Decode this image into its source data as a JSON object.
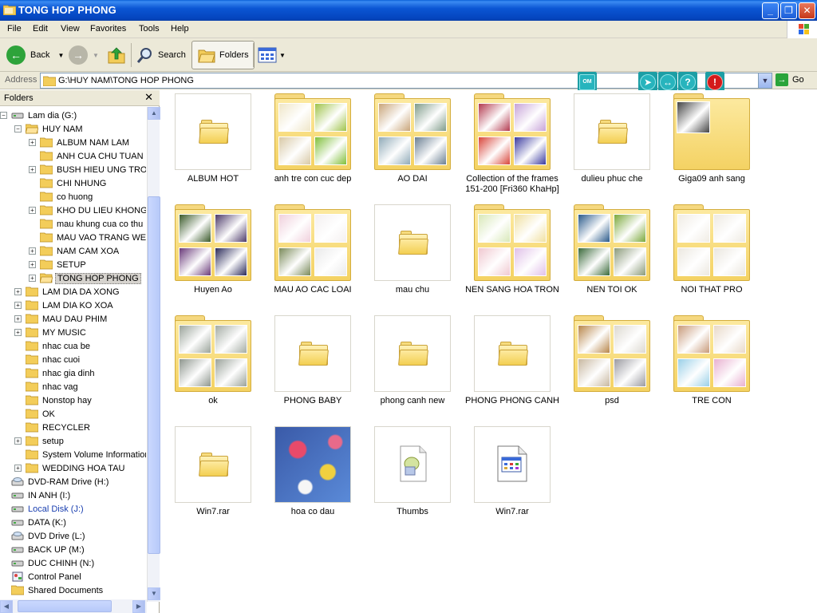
{
  "window": {
    "title": "TONG HOP PHONG",
    "minimize": "_",
    "maximize": "❐",
    "close": "✕"
  },
  "menu": [
    "File",
    "Edit",
    "View",
    "Favorites",
    "Tools",
    "Help"
  ],
  "toolbar": {
    "back_label": "Back",
    "search_label": "Search",
    "folders_label": "Folders"
  },
  "address": {
    "label": "Address",
    "value": "G:\\HUY NAM\\TONG HOP PHONG",
    "go_label": "Go"
  },
  "folders_pane": {
    "title": "Folders",
    "close": "✕",
    "tree": [
      {
        "label": "Lam dia (G:)",
        "level": 0,
        "expander": "-",
        "icon": "drive-icon"
      },
      {
        "label": "HUY NAM",
        "level": 1,
        "expander": "-",
        "icon": "folder-open-icon"
      },
      {
        "label": "ALBUM NAM LAM",
        "level": 2,
        "expander": "+",
        "icon": "folder-icon"
      },
      {
        "label": "ANH CUA CHU TUAN",
        "level": 2,
        "expander": "",
        "icon": "folder-icon"
      },
      {
        "label": "BUSH HIEU UNG TRONG",
        "level": 2,
        "expander": "+",
        "icon": "folder-icon"
      },
      {
        "label": "CHI NHUNG",
        "level": 2,
        "expander": "",
        "icon": "folder-icon"
      },
      {
        "label": "co huong",
        "level": 2,
        "expander": "",
        "icon": "folder-icon"
      },
      {
        "label": "KHO DU LIEU KHONG XO",
        "level": 2,
        "expander": "+",
        "icon": "folder-icon"
      },
      {
        "label": "mau khung cua co thu",
        "level": 2,
        "expander": "",
        "icon": "folder-icon"
      },
      {
        "label": "MAU VAO TRANG WEB",
        "level": 2,
        "expander": "",
        "icon": "folder-icon"
      },
      {
        "label": "NAM CAM XOA",
        "level": 2,
        "expander": "+",
        "icon": "folder-icon"
      },
      {
        "label": "SETUP",
        "level": 2,
        "expander": "+",
        "icon": "folder-icon"
      },
      {
        "label": "TONG HOP PHONG",
        "level": 2,
        "expander": "+",
        "icon": "folder-open-icon",
        "selected": true
      },
      {
        "label": "LAM DIA DA XONG",
        "level": 1,
        "expander": "+",
        "icon": "folder-icon"
      },
      {
        "label": "LAM DIA KO XOA",
        "level": 1,
        "expander": "+",
        "icon": "folder-icon"
      },
      {
        "label": "MAU DAU PHIM",
        "level": 1,
        "expander": "+",
        "icon": "folder-icon"
      },
      {
        "label": "MY MUSIC",
        "level": 1,
        "expander": "+",
        "icon": "folder-icon"
      },
      {
        "label": "nhac cua be",
        "level": 1,
        "expander": "",
        "icon": "folder-icon"
      },
      {
        "label": "nhac cuoi",
        "level": 1,
        "expander": "",
        "icon": "folder-icon"
      },
      {
        "label": "nhac gia dinh",
        "level": 1,
        "expander": "",
        "icon": "folder-icon"
      },
      {
        "label": "nhac vag",
        "level": 1,
        "expander": "",
        "icon": "folder-icon"
      },
      {
        "label": "Nonstop hay",
        "level": 1,
        "expander": "",
        "icon": "folder-icon"
      },
      {
        "label": "OK",
        "level": 1,
        "expander": "",
        "icon": "folder-icon"
      },
      {
        "label": "RECYCLER",
        "level": 1,
        "expander": "",
        "icon": "folder-icon"
      },
      {
        "label": "setup",
        "level": 1,
        "expander": "+",
        "icon": "folder-icon"
      },
      {
        "label": "System Volume Information",
        "level": 1,
        "expander": "",
        "icon": "folder-icon"
      },
      {
        "label": "WEDDING HOA TAU",
        "level": 1,
        "expander": "+",
        "icon": "folder-icon"
      },
      {
        "label": "DVD-RAM Drive (H:)",
        "level": 0,
        "expander": "",
        "icon": "dvd-drive-icon"
      },
      {
        "label": "IN ANH (I:)",
        "level": 0,
        "expander": "",
        "icon": "drive-icon"
      },
      {
        "label": "Local Disk (J:)",
        "level": 0,
        "expander": "",
        "icon": "drive-icon",
        "blue": true
      },
      {
        "label": "DATA (K:)",
        "level": 0,
        "expander": "",
        "icon": "drive-icon"
      },
      {
        "label": "DVD Drive (L:)",
        "level": 0,
        "expander": "",
        "icon": "dvd-drive-icon"
      },
      {
        "label": "BACK UP (M:)",
        "level": 0,
        "expander": "",
        "icon": "drive-icon"
      },
      {
        "label": "DUC CHINH (N:)",
        "level": 0,
        "expander": "",
        "icon": "drive-icon"
      },
      {
        "label": "Control Panel",
        "level": 0,
        "expander": "",
        "icon": "control-panel-icon"
      },
      {
        "label": "Shared Documents",
        "level": 0,
        "expander": "",
        "icon": "folder-icon"
      }
    ]
  },
  "items": [
    {
      "label": "ALBUM HOT",
      "kind": "empty-folder"
    },
    {
      "label": "anh tre con cuc dep",
      "kind": "photo-folder",
      "palette": [
        "#efe6c8",
        "#9fc34a",
        "#d8c9a6",
        "#7fbf3a"
      ]
    },
    {
      "label": "AO DAI",
      "kind": "photo-folder",
      "palette": [
        "#c9a57a",
        "#7f9b8a",
        "#8faab8",
        "#6b7f92"
      ]
    },
    {
      "label": "Collection of the frames 151-200 [Fri360 KhaHp]",
      "kind": "photo-folder",
      "palette": [
        "#b33a4f",
        "#c7a3d8",
        "#d8453a",
        "#3a3a9f"
      ]
    },
    {
      "label": "dulieu phuc che",
      "kind": "empty-folder"
    },
    {
      "label": "Giga09 anh sang",
      "kind": "single-photo-folder",
      "palette": [
        "#444444"
      ]
    },
    {
      "label": "Huyen Ao",
      "kind": "photo-folder",
      "palette": [
        "#3a5a2a",
        "#4c3a6a",
        "#6a3a7a",
        "#2a2a5a"
      ]
    },
    {
      "label": "MAU AO CAC LOAI",
      "kind": "photo-folder",
      "palette": [
        "#f0d0dc",
        "#f4f0f0",
        "#7a8a5a",
        "#eaeaea"
      ]
    },
    {
      "label": "mau chu",
      "kind": "empty-folder"
    },
    {
      "label": "NEN SANG HOA TRON",
      "kind": "photo-folder",
      "palette": [
        "#d8e8b8",
        "#f0e0a0",
        "#f0c8d0",
        "#e0c0e8"
      ]
    },
    {
      "label": "NEN TOI OK",
      "kind": "photo-folder",
      "palette": [
        "#2a5a8a",
        "#7aa83a",
        "#3a6a3a",
        "#8a9a7a"
      ]
    },
    {
      "label": "NOI THAT PRO",
      "kind": "photo-folder",
      "palette": [
        "#f0ece4",
        "#eeeae2",
        "#ece8e0",
        "#eae6de"
      ]
    },
    {
      "label": "ok",
      "kind": "photo-folder",
      "palette": [
        "#9aa39a",
        "#a4aca4",
        "#8e968e",
        "#9aa29a"
      ]
    },
    {
      "label": "PHONG BABY",
      "kind": "empty-folder"
    },
    {
      "label": "phong canh new",
      "kind": "empty-folder"
    },
    {
      "label": "PHONG PHONG CANH",
      "kind": "empty-folder"
    },
    {
      "label": "psd",
      "kind": "photo-folder",
      "palette": [
        "#b8864a",
        "#dcd8d0",
        "#c8b8a0",
        "#9a9aa0"
      ]
    },
    {
      "label": "TRE CON",
      "kind": "photo-folder",
      "palette": [
        "#c89a7a",
        "#e8d8c8",
        "#9ad0e8",
        "#e8b0d0"
      ]
    },
    {
      "label": "Win7.rar",
      "kind": "empty-folder"
    },
    {
      "label": "hoa co dau",
      "kind": "image-file",
      "palette": [
        "#3a5aa8",
        "#e84a6a",
        "#f0d040"
      ]
    },
    {
      "label": "Thumbs",
      "kind": "thumbs-file"
    },
    {
      "label": "Win7.rar",
      "kind": "rar-file"
    }
  ],
  "colors": {
    "titlebar": "#0b56d4",
    "chrome": "#ece9d8",
    "folder_yellow": "#f4d263",
    "accent_teal": "#1c9ea5",
    "alert_red": "#d41a1a"
  }
}
